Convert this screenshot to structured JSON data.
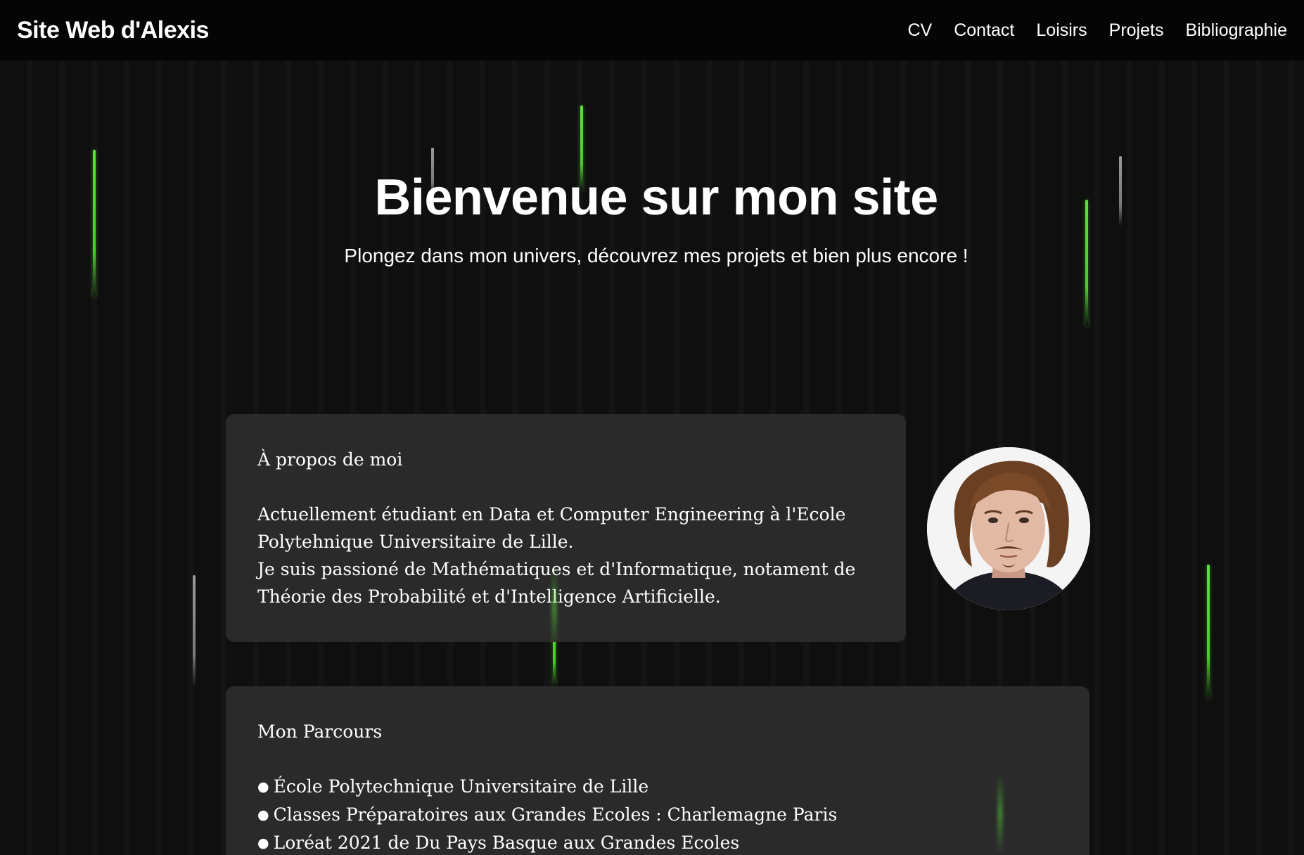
{
  "header": {
    "site_title": "Site Web d'Alexis",
    "nav": [
      {
        "label": "CV"
      },
      {
        "label": "Contact"
      },
      {
        "label": "Loisirs"
      },
      {
        "label": "Projets"
      },
      {
        "label": "Bibliographie"
      }
    ]
  },
  "hero": {
    "title": "Bienvenue sur mon site",
    "subtitle": "Plongez dans mon univers, découvrez mes projets et bien plus encore !"
  },
  "about": {
    "heading": "À propos de moi",
    "lines": [
      "Actuellement étudiant en Data et Computer Engineering à l'Ecole",
      "Polytehnique Universitaire de Lille.",
      "Je suis passioné de Mathématiques et d'Informatique, notament de",
      "Théorie des Probabilité et d'Intelligence Artificielle."
    ]
  },
  "parcours": {
    "heading": "Mon Parcours",
    "items": [
      "École Polytechnique Universitaire de Lille",
      "Classes Préparatoires aux Grandes Ecoles : Charlemagne Paris",
      "Loréat 2021 de Du Pays Basque aux Grandes Ecoles"
    ]
  },
  "theme": {
    "background": "#0f0f0f",
    "navbar": "#050505",
    "card": "#2a2a2a",
    "rain_green": "#5be23a",
    "rain_grey": "#9a9a9a"
  }
}
